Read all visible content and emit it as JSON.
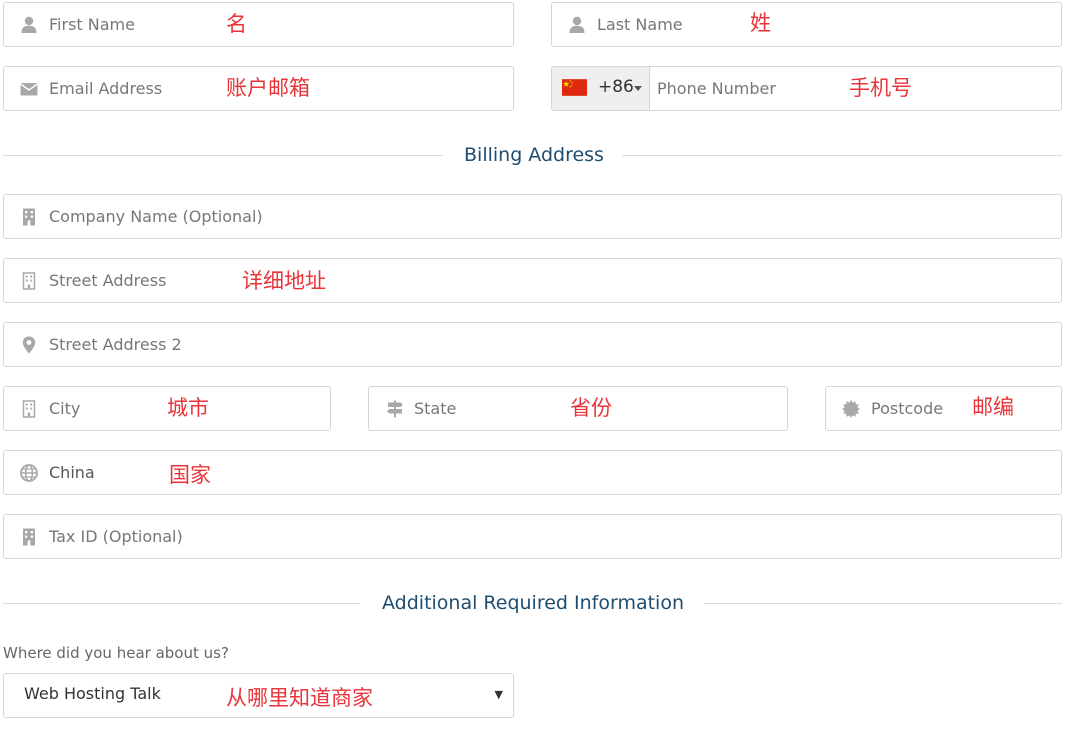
{
  "contact": {
    "first_name": {
      "placeholder": "First Name",
      "annotation": "名"
    },
    "last_name": {
      "placeholder": "Last Name",
      "annotation": "姓"
    },
    "email": {
      "placeholder": "Email Address",
      "annotation": "账户邮箱"
    },
    "phone": {
      "dial_code": "+86",
      "placeholder": "Phone Number",
      "annotation": "手机号"
    }
  },
  "billing": {
    "section_title": "Billing Address",
    "company": {
      "placeholder": "Company Name (Optional)"
    },
    "street": {
      "placeholder": "Street Address",
      "annotation": "详细地址"
    },
    "street2": {
      "placeholder": "Street Address 2"
    },
    "city": {
      "placeholder": "City",
      "annotation": "城市"
    },
    "state": {
      "placeholder": "State",
      "annotation": "省份"
    },
    "postcode": {
      "placeholder": "Postcode",
      "annotation": "邮编"
    },
    "country": {
      "value": "China",
      "annotation": "国家"
    },
    "tax_id": {
      "placeholder": "Tax ID (Optional)"
    }
  },
  "additional": {
    "section_title": "Additional Required Information",
    "question_label": "Where did you hear about us?",
    "selected_value": "Web Hosting Talk",
    "annotation": "从哪里知道商家"
  },
  "colors": {
    "annotation": "#e8343a",
    "section_title": "#1f4d70",
    "border": "#d6d6d6",
    "icon": "#a8a8a8"
  },
  "icons": {
    "first_name": "user-icon",
    "last_name": "user-icon",
    "email": "envelope-icon",
    "company": "building-icon",
    "street": "building-outline-icon",
    "street2": "map-marker-icon",
    "city": "building-outline-icon",
    "state": "signpost-icon",
    "postcode": "certificate-icon",
    "country": "globe-icon",
    "tax_id": "building-icon",
    "phone_flag": "china-flag-icon"
  }
}
